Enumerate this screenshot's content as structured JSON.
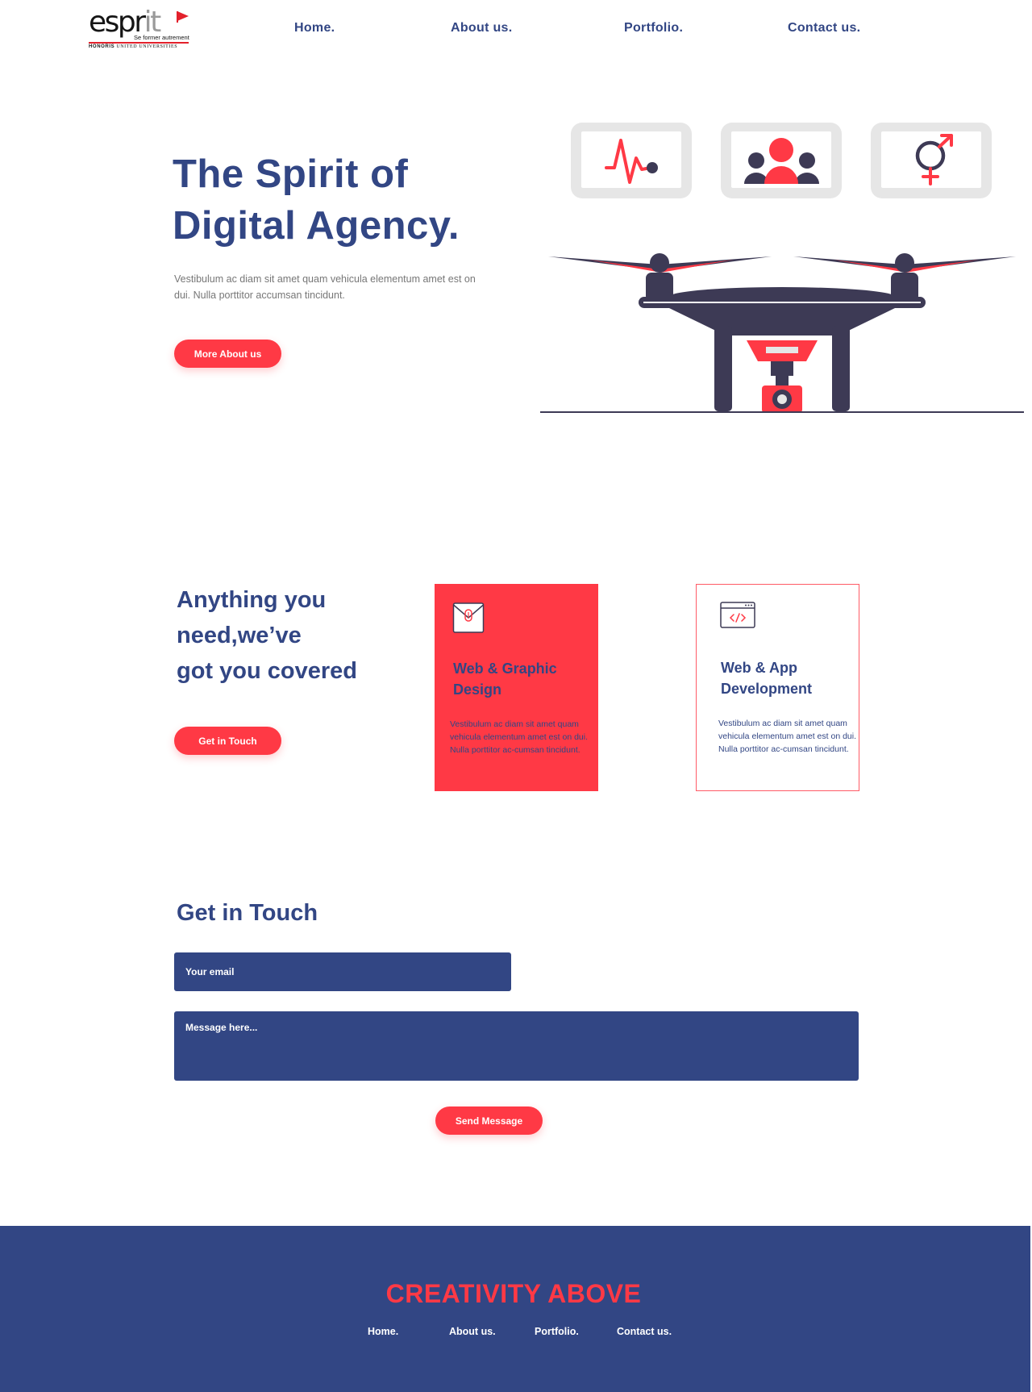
{
  "logo": {
    "word_dark": "espr",
    "word_gray": "it",
    "tagline": "Se former autrement",
    "sub_bold": "HONORIS",
    "sub_rest": "UNITED UNIVERSITIES"
  },
  "nav": {
    "items": [
      "Home.",
      "About us.",
      "Portfolio.",
      "Contact us."
    ]
  },
  "hero": {
    "title_line1": "The Spirit of",
    "title_line2": "Digital Agency.",
    "text": "Vestibulum ac diam sit amet quam vehicula elementum amet est on dui. Nulla porttitor accumsan tincidunt.",
    "button": "More About us",
    "screens": [
      "heartbeat-icon",
      "people-icon",
      "gender-icon"
    ]
  },
  "services": {
    "heading_line1": "Anything you",
    "heading_line2": "need,we’ve",
    "heading_line3": "got you covered",
    "button": "Get in Touch",
    "cards": [
      {
        "icon": "envelope-icon",
        "title_line1": "Web & Graphic",
        "title_line2": "Design",
        "text": "Vestibulum ac diam sit amet quam vehicula elementum amet est on dui. Nulla porttitor ac-cumsan tincidunt."
      },
      {
        "icon": "code-window-icon",
        "title_line1": "Web & App",
        "title_line2": "Development",
        "text": "Vestibulum ac diam sit amet quam vehicula elementum amet est on dui. Nulla porttitor ac-cumsan tincidunt."
      }
    ]
  },
  "contact": {
    "title": "Get in Touch",
    "email_placeholder": "Your email",
    "message_placeholder": "Message here...",
    "button": "Send Message"
  },
  "footer": {
    "title": "CREATIVITY ABOVE",
    "items": [
      "Home.",
      "About us.",
      "Portfolio.",
      "Contact us."
    ]
  },
  "colors": {
    "primary_blue": "#324684",
    "accent_red": "#ff3945",
    "dark_navy": "#3d3a55",
    "screen_gray": "#e6e6e6"
  }
}
